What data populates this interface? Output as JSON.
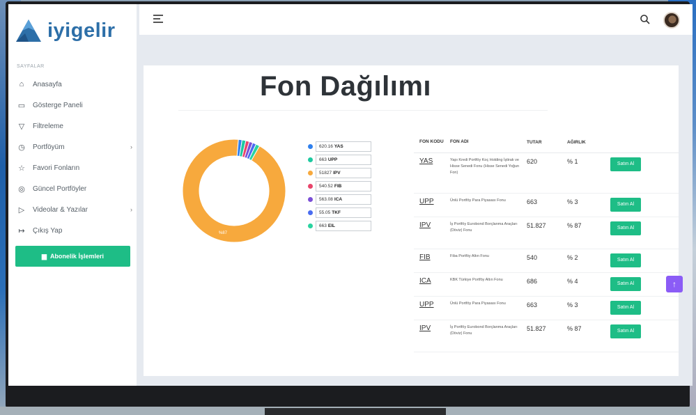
{
  "brand": {
    "name": "iyigelir",
    "color": "#2d6fa8"
  },
  "sidebar": {
    "section_title": "SAYFALAR",
    "items": [
      {
        "label": "Anasayfa",
        "icon": "home-icon",
        "glyph": "⌂",
        "chevron": ""
      },
      {
        "label": "Gösterge Paneli",
        "icon": "monitor-icon",
        "glyph": "▭",
        "chevron": ""
      },
      {
        "label": "Filtreleme",
        "icon": "filter-icon",
        "glyph": "▽",
        "chevron": ""
      },
      {
        "label": "Portföyüm",
        "icon": "clock-icon",
        "glyph": "◷",
        "chevron": "›"
      },
      {
        "label": "Favori Fonların",
        "icon": "star-icon",
        "glyph": "☆",
        "chevron": ""
      },
      {
        "label": "Güncel Portföyler",
        "icon": "target-icon",
        "glyph": "◎",
        "chevron": ""
      },
      {
        "label": "Videolar & Yazılar",
        "icon": "video-icon",
        "glyph": "▷",
        "chevron": "›"
      },
      {
        "label": "Çıkış Yap",
        "icon": "logout-icon",
        "glyph": "↦",
        "chevron": ""
      }
    ],
    "subscription_button": "Abonelik İşlemleri"
  },
  "page": {
    "title": "Fon Dağılımı"
  },
  "chart_data": {
    "type": "pie",
    "categories": [
      "YAS",
      "UPP",
      "IPV",
      "FIB",
      "ICA",
      "TKF",
      "EIL"
    ],
    "values": [
      620.16,
      663,
      51827,
      540.52,
      563.08,
      55.05,
      663
    ],
    "colors": [
      "#2f80ed",
      "#1ec9a0",
      "#f7a93d",
      "#e8456b",
      "#7b4fd6",
      "#4a6cf0",
      "#2ad3a0"
    ],
    "slice_label": "%87"
  },
  "legend": [
    {
      "value": "620.16",
      "code": "YAS"
    },
    {
      "value": "663",
      "code": "UPP"
    },
    {
      "value": "51827",
      "code": "IPV"
    },
    {
      "value": "540.52",
      "code": "FIB"
    },
    {
      "value": "563.08",
      "code": "ICA"
    },
    {
      "value": "55.05",
      "code": "TKF"
    },
    {
      "value": "663",
      "code": "EIL"
    }
  ],
  "table": {
    "headers": {
      "code": "FON KODU",
      "name": "FON ADI",
      "amount": "TUTAR",
      "weight": "AĞIRLIK"
    },
    "buy_label": "Satın Al",
    "rows": [
      {
        "code": "YAS",
        "name": "Yapı Kredi Portföy Koç Holding İştirak ve Hisse Senedi Fonu (Hisse Senedi Yoğun Fon)",
        "amount": "620",
        "weight": "% 1"
      },
      {
        "code": "UPP",
        "name": "Ünlü Portföy Para Piyasası Fonu",
        "amount": "663",
        "weight": "% 3"
      },
      {
        "code": "IPV",
        "name": "İş Portföy Eurobond Borçlanma Araçları (Döviz) Fonu",
        "amount": "51.827",
        "weight": "% 87"
      },
      {
        "code": "FIB",
        "name": "Fiba Portföy Altın Fonu",
        "amount": "540",
        "weight": "% 2"
      },
      {
        "code": "ICA",
        "name": "KBK Türkiye Portföy Altın Fonu",
        "amount": "686",
        "weight": "% 4"
      },
      {
        "code": "UPP",
        "name": "Ünlü Portföy Para Piyasası Fonu",
        "amount": "663",
        "weight": "% 3"
      },
      {
        "code": "IPV",
        "name": "İş Portföy Eurobond Borçlanma Araçları (Döviz) Fonu",
        "amount": "51.827",
        "weight": "% 87"
      }
    ]
  }
}
